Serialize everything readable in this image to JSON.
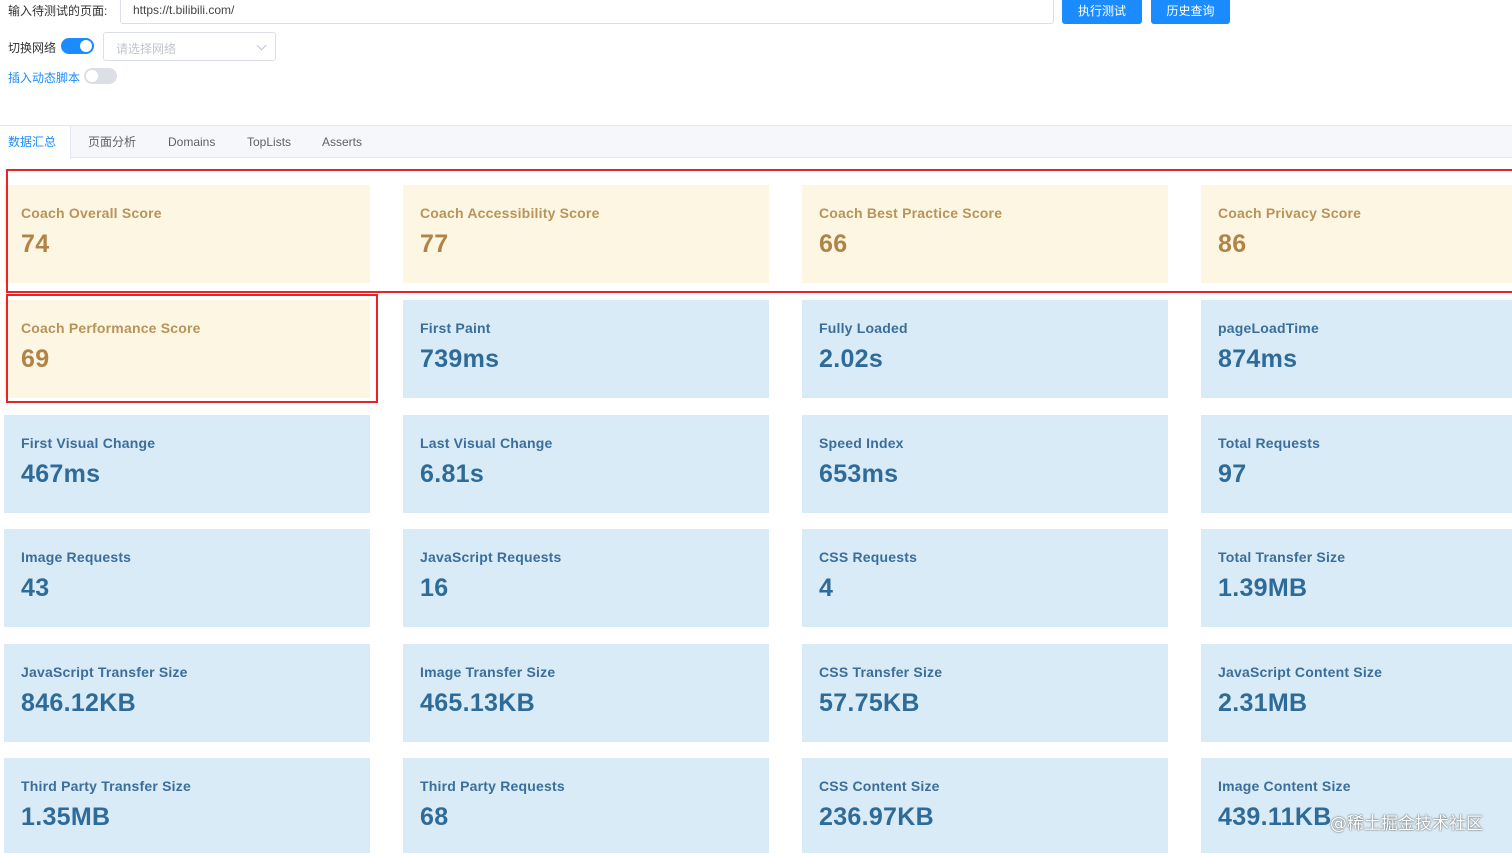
{
  "form": {
    "url_label": "输入待测试的页面:",
    "url_value": "https://t.bilibili.com/",
    "run_button": "执行测试",
    "history_button": "历史查询",
    "network_label": "切换网络",
    "network_placeholder": "请选择网络",
    "script_label": "插入动态脚本"
  },
  "tabs": [
    {
      "label": "数据汇总"
    },
    {
      "label": "页面分析"
    },
    {
      "label": "Domains"
    },
    {
      "label": "TopLists"
    },
    {
      "label": "Asserts"
    }
  ],
  "cards": [
    {
      "label": "Coach Overall Score",
      "value": "74"
    },
    {
      "label": "Coach Accessibility Score",
      "value": "77"
    },
    {
      "label": "Coach Best Practice Score",
      "value": "66"
    },
    {
      "label": "Coach Privacy Score",
      "value": "86"
    },
    {
      "label": "Coach Performance Score",
      "value": "69"
    },
    {
      "label": "First Paint",
      "value": "739ms"
    },
    {
      "label": "Fully Loaded",
      "value": "2.02s"
    },
    {
      "label": "pageLoadTime",
      "value": "874ms"
    },
    {
      "label": "First Visual Change",
      "value": "467ms"
    },
    {
      "label": "Last Visual Change",
      "value": "6.81s"
    },
    {
      "label": "Speed Index",
      "value": "653ms"
    },
    {
      "label": "Total Requests",
      "value": "97"
    },
    {
      "label": "Image Requests",
      "value": "43"
    },
    {
      "label": "JavaScript Requests",
      "value": "16"
    },
    {
      "label": "CSS Requests",
      "value": "4"
    },
    {
      "label": "Total Transfer Size",
      "value": "1.39MB"
    },
    {
      "label": "JavaScript Transfer Size",
      "value": "846.12KB"
    },
    {
      "label": "Image Transfer Size",
      "value": "465.13KB"
    },
    {
      "label": "CSS Transfer Size",
      "value": "57.75KB"
    },
    {
      "label": "JavaScript Content Size",
      "value": "2.31MB"
    },
    {
      "label": "Third Party Transfer Size",
      "value": "1.35MB"
    },
    {
      "label": "Third Party Requests",
      "value": "68"
    },
    {
      "label": "CSS Content Size",
      "value": "236.97KB"
    },
    {
      "label": "Image Content Size",
      "value": "439.11KB"
    }
  ],
  "watermark": "@稀土掘金技术社区",
  "colors": {
    "primary": "#1a8cff",
    "score_card_bg": "#fdf6e3",
    "metric_card_bg": "#d9ebf6",
    "highlight_border": "#e8242a"
  }
}
